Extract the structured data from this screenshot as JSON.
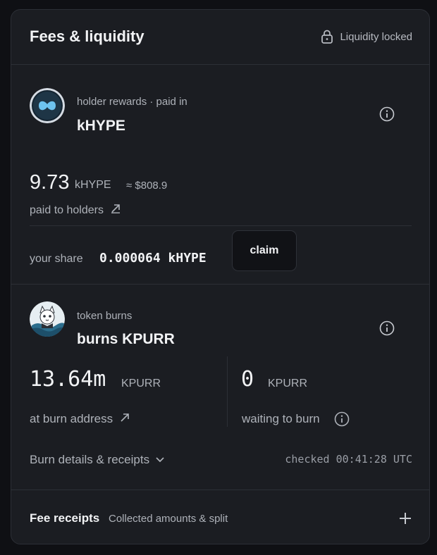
{
  "header": {
    "title": "Fees & liquidity",
    "lock_label": "Liquidity locked",
    "lock_icon": "lock-icon"
  },
  "rewards": {
    "kicker": "holder rewards · paid in",
    "token": "kHYPE",
    "amount": "9.73",
    "amount_unit": "kHYPE",
    "usd": "≈ $808.9",
    "caption": "paid to holders",
    "share_label": "your share",
    "share_value": "0.000064 kHYPE",
    "claim_label": "claim"
  },
  "burns": {
    "kicker": "token burns",
    "title": "burns KPURR",
    "burned_amount": "13.64m",
    "burned_unit": "KPURR",
    "burned_caption": "at burn address",
    "waiting_amount": "0",
    "waiting_unit": "KPURR",
    "waiting_caption": "waiting to burn",
    "details_label": "Burn details & receipts",
    "checked": "checked 00:41:28 UTC"
  },
  "footer": {
    "title": "Fee receipts",
    "subtitle": "Collected amounts & split"
  },
  "colors": {
    "background": "#0f1014",
    "card": "#1b1d22",
    "border": "#2c2f36",
    "text_primary": "#f2f3f5",
    "text_muted": "#aeb2b9"
  }
}
